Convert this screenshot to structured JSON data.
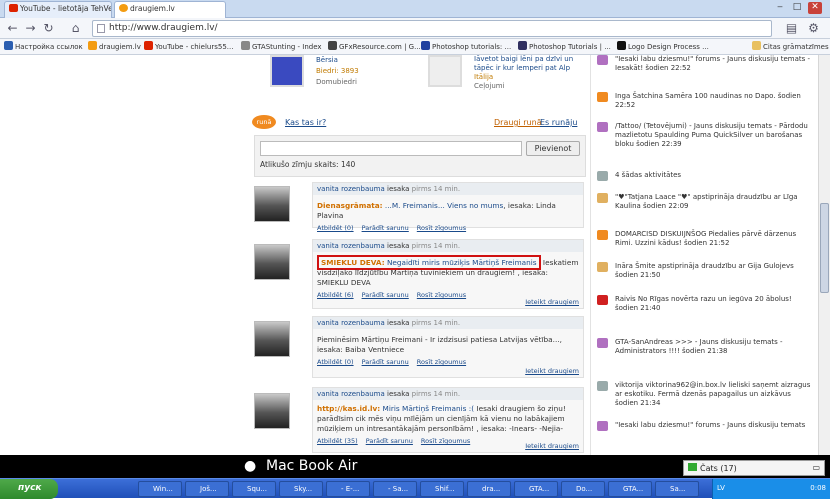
{
  "tabs": [
    {
      "label": "YouTube - lietotāja TehVen..."
    },
    {
      "label": "draugiem.lv"
    }
  ],
  "url": "http://www.draugiem.lv/",
  "bookmarks": [
    "Настройка ссылок",
    "draugiem.lv",
    "YouTube - chielurs55...",
    "GTAStunting - Index",
    "GFxResource.com | G...",
    "Photoshop tutorials: ...",
    "Photoshop Tutorials | ...",
    "Logo Design Process ...",
    "Citas grāmatzīmes"
  ],
  "profiles": {
    "left_link": "Bērsia",
    "left_sub": "Biedri: 3893",
    "left_sub2": "Domubiedri",
    "right_link": "Iāvetot baigi lēni pa dzīvi un tāpēc ir kur lemperi pat Alp",
    "right_sub": "Itālija",
    "right_sub2": "Ceļojumi"
  },
  "runa": {
    "badge": "runā",
    "question": "Kas tas ir?",
    "friends_link": "Draugi runā",
    "self_link": "Es runāju",
    "button": "Pievienot",
    "chars_left": "Atlikušo zīmju skaits: 140"
  },
  "posts": [
    {
      "author": "vanita rozenbauma",
      "action": "iesaka",
      "time": "pirms 14 min.",
      "tag": "Dienasgrāmata:",
      "body": "...M. Freimanis... Viens no mums",
      "tail": ", iesaka: Linda Plavina",
      "links": [
        "Atbildēt (0)",
        "Parādīt sarunu",
        "Rosīt zīgoumus"
      ],
      "report": ""
    },
    {
      "author": "vanita rozenbauma",
      "action": "iesaka",
      "time": "pirms 14 min.",
      "tag": "SMIEKLU DEVA:",
      "body": "Negaidīti miris mūziķis Mārtiņš Freimanis",
      "tail": " Ieskatiem visdziļāko līdzjūtību Mārtiņa tuviniekiem un draugiem! , iesaka: SMIEKLU DEVA",
      "links": [
        "Atbildēt (6)",
        "Parādīt sarunu",
        "Rosīt zīgoumus"
      ],
      "report": "Ieteikt draugiem"
    },
    {
      "author": "vanita rozenbauma",
      "action": "iesaka",
      "time": "pirms 14 min.",
      "tag": "",
      "body": "Pieminēsim Mārtiņu Freimani - Ir izdzisusi patiesa Latvijas vētība...",
      "tail": ", iesaka: Baiba Ventniece",
      "links": [
        "Atbildēt (0)",
        "Parādīt sarunu",
        "Rosīt zīgoumus"
      ],
      "report": "Ieteikt draugiem"
    },
    {
      "author": "vanita rozenbauma",
      "action": "iesaka",
      "time": "pirms 14 min.",
      "tag": "http://kas.id.lv:",
      "body": "Miris Mārtiņš Freimanis :(",
      "tail": " Iesaki draugiem šo ziņu! parādīsim cik mēs viņu mīlējām un cienījām kā vienu no labākajiem mūziķiem un intresantākajām personībām! , iesaka: -Inears- -Nejia-",
      "links": [
        "Atbildēt (35)",
        "Parādīt sarunu",
        "Rosīt zīgoumus"
      ],
      "report": "Ieteikt draugiem"
    }
  ],
  "right_feed": [
    {
      "text": "\"Iesaki labu dziesmu!\" forums - Jauns diskusiju temats - Iesakāt! šodien 22:52",
      "color": "#b070c0"
    },
    {
      "text": "Inga Šatchina Samēra 100 naudinas no Dapo. šodien 22:52",
      "color": "#f08a20"
    },
    {
      "text": "/Tattoo/ (Tetovējumi) - Jauns diskusiju temats - Pārdodu mazlietotu Spaulding Puma QuickSilver un barošanas bloku šodien 22:39",
      "color": "#b070c0"
    },
    {
      "text": "4 šādas aktivitātes",
      "color": "#9aa"
    },
    {
      "text": "\"♥\"Tatjana Laace \"♥\" apstiprināja draudzību ar Līga Kaulina šodien 22:09",
      "color": "#e0b060"
    },
    {
      "text": "DOMARCISD DISKUIJNŠOG Piedalies pārvē dārzenus Rimi. Uzzini kādus! šodien 21:52",
      "color": "#f08a20"
    },
    {
      "text": "Ināra Šmite apstiprināja draudzību ar Gija Gulojevs šodien 21:50",
      "color": "#e0b060"
    },
    {
      "text": "Raivis No Rīgas novērta razu un iegūva 20 ābolus! šodien 21:40",
      "color": "#d02020"
    },
    {
      "text": "GTA-SanAndreas >>> - Jauns diskusiju temats - Administrators !!!! šodien 21:38",
      "color": "#b070c0"
    },
    {
      "text": "viktorija viktorina962@in.box.lv lieliski saņemt aizragus ar eskotiku. Fermā dzenās papagailus un aizkāvus šodien 21:34",
      "color": "#9aa"
    },
    {
      "text": "\"Iesaki labu dziesmu!\" forums - Jauns diskusiju temats",
      "color": "#b070c0"
    }
  ],
  "mac_label": "Mac Book Air",
  "chat_label": "Čats (17)",
  "taskbar": {
    "start": "пуск",
    "items": [
      "Win...",
      "Još...",
      "Squ...",
      "Sky...",
      "- E-...",
      "- Sa...",
      "Shif...",
      "dra...",
      "GTA...",
      "Do...",
      "GTA...",
      "Sa..."
    ],
    "lang": "LV",
    "clock": "0:08"
  }
}
